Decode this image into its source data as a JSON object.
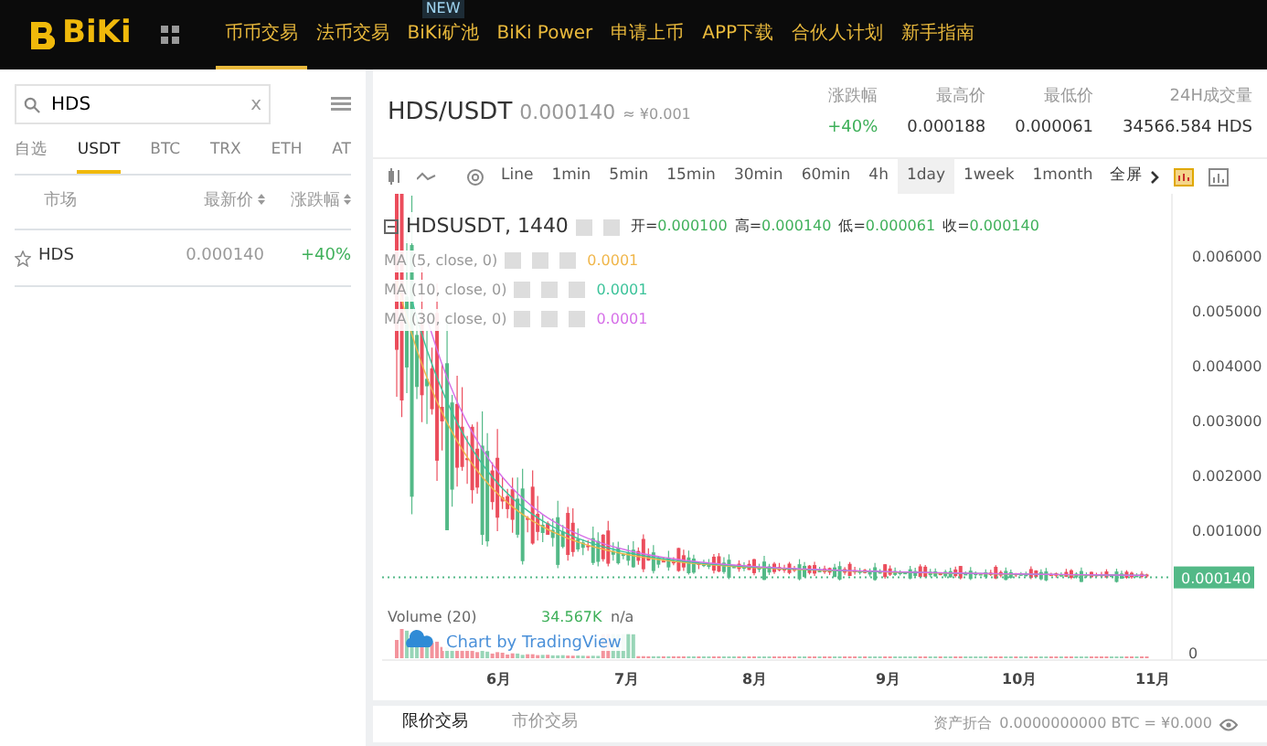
{
  "nav": {
    "logo": "BiKi",
    "items": [
      {
        "label": "币币交易",
        "selected": true
      },
      {
        "label": "法币交易",
        "selected": false
      },
      {
        "label": "BiKi矿池",
        "selected": false,
        "badge": "NEW"
      },
      {
        "label": "BiKi Power",
        "selected": false
      },
      {
        "label": "申请上币",
        "selected": false
      },
      {
        "label": "APP下载",
        "selected": false
      },
      {
        "label": "合伙人计划",
        "selected": false
      },
      {
        "label": "新手指南",
        "selected": false
      }
    ]
  },
  "market": {
    "search": {
      "value": "HDS",
      "clear": "x"
    },
    "tabs": [
      {
        "label": "自选",
        "selected": false
      },
      {
        "label": "USDT",
        "selected": true
      },
      {
        "label": "BTC",
        "selected": false
      },
      {
        "label": "TRX",
        "selected": false
      },
      {
        "label": "ETH",
        "selected": false
      },
      {
        "label": "AT",
        "selected": false
      }
    ],
    "columns": [
      "市场",
      "最新价",
      "涨跌幅"
    ],
    "rows": [
      {
        "favorite": false,
        "pair": "HDS",
        "price": "0.000140",
        "change": "+40%"
      }
    ]
  },
  "ticker": {
    "pair": "HDS/USDT",
    "price": "0.000140",
    "cny": "≈ ¥0.001",
    "stats": [
      {
        "label": "涨跌幅",
        "value": "+40%",
        "kind": "up"
      },
      {
        "label": "最高价",
        "value": "0.000188",
        "kind": "plain"
      },
      {
        "label": "最低价",
        "value": "0.000061",
        "kind": "plain"
      },
      {
        "label": "24H成交量",
        "value": "34566.584 HDS",
        "kind": "plain"
      }
    ]
  },
  "toolbar": {
    "intervals": [
      {
        "label": "Line",
        "selected": false
      },
      {
        "label": "1min",
        "selected": false
      },
      {
        "label": "5min",
        "selected": false
      },
      {
        "label": "15min",
        "selected": false
      },
      {
        "label": "30min",
        "selected": false
      },
      {
        "label": "60min",
        "selected": false
      },
      {
        "label": "4h",
        "selected": false
      },
      {
        "label": "1day",
        "selected": true
      },
      {
        "label": "1week",
        "selected": false
      },
      {
        "label": "1month",
        "selected": false
      }
    ],
    "fullscreen": "全屏"
  },
  "chart": {
    "symbol": "HDSUSDT, 1440",
    "ohlc": [
      {
        "label": "开=",
        "value": "0.000100"
      },
      {
        "label": "高=",
        "value": "0.000140"
      },
      {
        "label": "低=",
        "value": "0.000061"
      },
      {
        "label": "收=",
        "value": "0.000140"
      }
    ],
    "ma": [
      {
        "label": "MA (5, close, 0)",
        "value": "0.0001",
        "color": "#f0b64a"
      },
      {
        "label": "MA (10, close, 0)",
        "value": "0.0001",
        "color": "#3cc39a"
      },
      {
        "label": "MA (30, close, 0)",
        "value": "0.0001",
        "color": "#d66fe8"
      }
    ],
    "yticks": [
      "0.006000",
      "0.005000",
      "0.004000",
      "0.003000",
      "0.002000",
      "0.001000"
    ],
    "last_price": "0.000140",
    "volume": {
      "label": "Volume (20)",
      "value": "34.567K",
      "extra": "n/a",
      "zero": "0"
    },
    "credit": "Chart by TradingView",
    "xticks": [
      "6月",
      "7月",
      "8月",
      "9月",
      "10月",
      "11月"
    ]
  },
  "order_tabs": [
    {
      "label": "限价交易",
      "selected": true
    },
    {
      "label": "市价交易",
      "selected": false
    }
  ],
  "assets": {
    "label": "资产折合",
    "value": "0.0000000000 BTC = ¥0.000"
  }
}
